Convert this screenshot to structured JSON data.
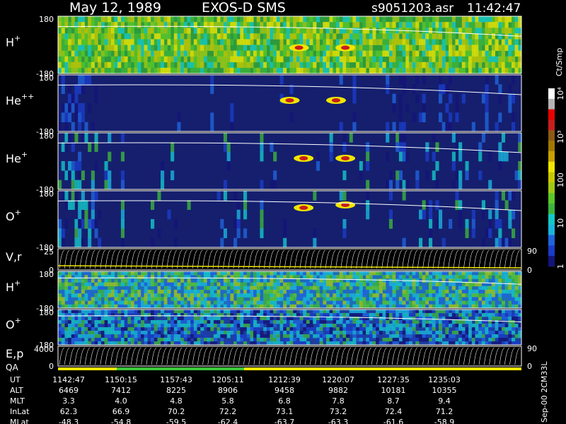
{
  "header": {
    "date": "May 12, 1989",
    "instrument": "EXOS-D SMS",
    "file": "s9051203.asr",
    "time": "11:42:47"
  },
  "colorbar": {
    "unit_label": "Ct/Smp",
    "tick_labels": [
      "1",
      "10",
      "100",
      "10³",
      "10⁴"
    ],
    "colors": [
      "#141478",
      "#1a3cc8",
      "#1f64dc",
      "#1ab4dc",
      "#14c8c8",
      "#3cb43c",
      "#5ac828",
      "#a0c814",
      "#c8c800",
      "#f0e600",
      "#c8a000",
      "#a07800",
      "#8c5a14",
      "#c81e1e",
      "#e60000",
      "#b4b4b4",
      "#ffffff"
    ]
  },
  "footer": {
    "version": "Sep-00 2CM33L",
    "rows": [
      {
        "label": "UT",
        "values": [
          "1142:47",
          "1150:15",
          "1157:43",
          "1205:11",
          "1212:39",
          "1220:07",
          "1227:35",
          "1235:03"
        ]
      },
      {
        "label": "ALT",
        "values": [
          "6469",
          "7412",
          "8225",
          "8906",
          "9458",
          "9882",
          "10181",
          "10355"
        ]
      },
      {
        "label": "MLT",
        "values": [
          "3.3",
          "4.0",
          "4.8",
          "5.8",
          "6.8",
          "7.8",
          "8.7",
          "9.4"
        ]
      },
      {
        "label": "InLat",
        "values": [
          "62.3",
          "66.9",
          "70.2",
          "72.2",
          "73.1",
          "73.2",
          "72.4",
          "71.2"
        ]
      },
      {
        "label": "MLat",
        "values": [
          "-48.3",
          "-54.8",
          "-59.5",
          "-62.4",
          "-63.7",
          "-63.3",
          "-61.6",
          "-58.9"
        ]
      }
    ]
  },
  "chart_data": {
    "type": "heatmap",
    "x_axis": "UT",
    "x_ticks": [
      "1142:47",
      "1150:15",
      "1157:43",
      "1205:11",
      "1212:39",
      "1220:07",
      "1227:35",
      "1235:03"
    ],
    "color_scale": "log",
    "color_range": [
      1,
      10000
    ],
    "color_unit": "Ct/Smp",
    "panels": [
      {
        "species": "H",
        "charge": "+",
        "ylim": [
          -180,
          180
        ],
        "ytick_labels": [
          "180",
          "-180"
        ],
        "background": "#2d9a3c",
        "intensity": "high",
        "hotspots": [
          {
            "t": 0.52,
            "v": 0.55
          },
          {
            "t": 0.62,
            "v": 0.55
          }
        ]
      },
      {
        "species": "He",
        "charge": "++",
        "ylim": [
          -180,
          180
        ],
        "ytick_labels": [
          "180",
          "-180"
        ],
        "background": "#151f6e",
        "intensity": "low",
        "hotspots": [
          {
            "t": 0.5,
            "v": 0.45
          },
          {
            "t": 0.6,
            "v": 0.45
          }
        ]
      },
      {
        "species": "He",
        "charge": "+",
        "ylim": [
          -180,
          180
        ],
        "ytick_labels": [
          "180",
          "-180"
        ],
        "background": "#151f6e",
        "intensity": "medium",
        "hotspots": [
          {
            "t": 0.53,
            "v": 0.45
          },
          {
            "t": 0.62,
            "v": 0.45
          }
        ]
      },
      {
        "species": "O",
        "charge": "+",
        "ylim": [
          -180,
          180
        ],
        "ytick_labels": [
          "180",
          "-180"
        ],
        "background": "#151f6e",
        "intensity": "medium",
        "hotspots": [
          {
            "t": 0.53,
            "v": 0.3
          },
          {
            "t": 0.62,
            "v": 0.25
          }
        ]
      },
      {
        "species": "V,r",
        "charge": "",
        "kind": "line",
        "ylim": [
          0,
          25
        ],
        "ytick_labels": [
          "25",
          "0"
        ],
        "right_tick_labels": [
          "90",
          "0"
        ]
      },
      {
        "species": "H",
        "charge": "+",
        "ylim": [
          -180,
          180
        ],
        "ytick_labels": [
          "180",
          "-180"
        ],
        "background": "#1e6eb4",
        "intensity": "medium-high"
      },
      {
        "species": "O",
        "charge": "+",
        "ylim": [
          -180,
          180
        ],
        "ytick_labels": [
          "180",
          "-180"
        ],
        "background": "#1c3f9c",
        "intensity": "medium"
      },
      {
        "species": "E,p",
        "charge": "",
        "kind": "line",
        "ylim": [
          0,
          4000
        ],
        "ytick_labels": [
          "4000",
          "0"
        ],
        "right_tick_labels": [
          "90",
          "0"
        ]
      }
    ],
    "qa_label": "QA"
  }
}
